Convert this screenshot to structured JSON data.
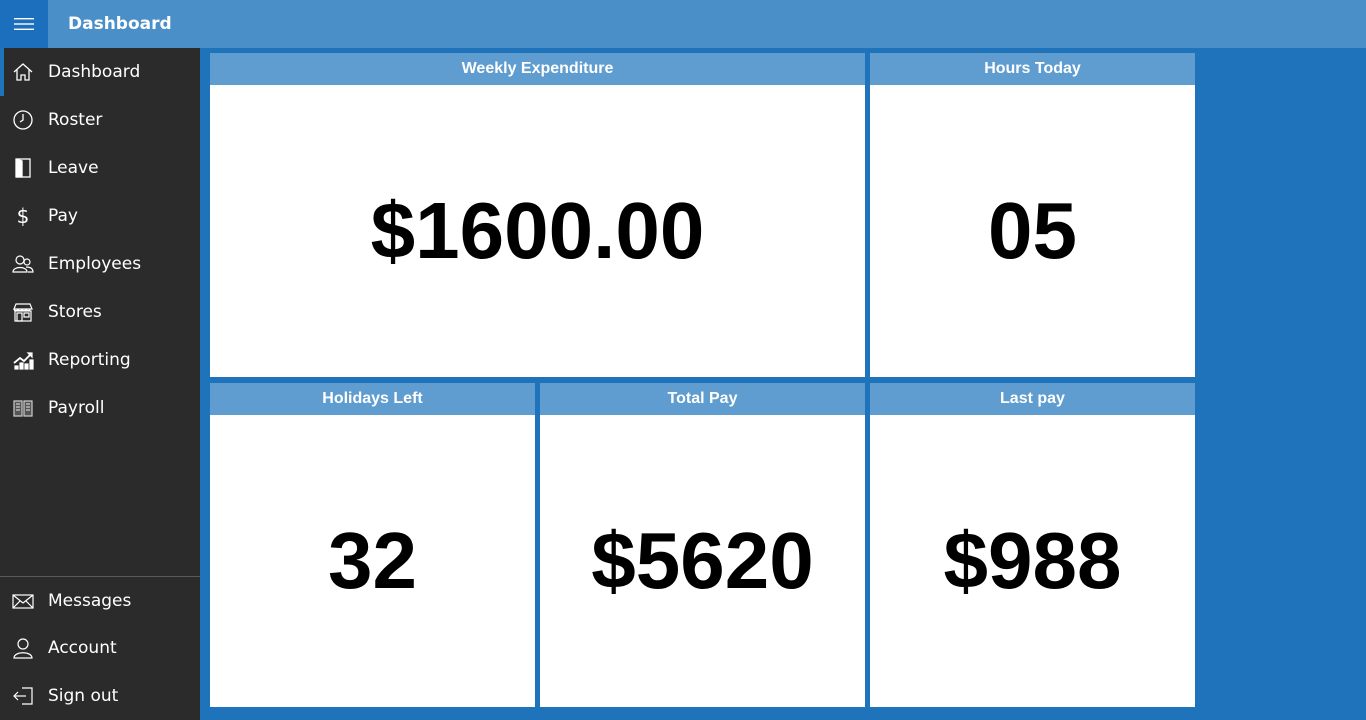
{
  "header": {
    "menu_icon": "hamburger-icon",
    "title": "Dashboard"
  },
  "sidebar": {
    "items": [
      {
        "label": "Dashboard",
        "icon": "home-icon",
        "active": true
      },
      {
        "label": "Roster",
        "icon": "clock-icon"
      },
      {
        "label": "Leave",
        "icon": "door-icon"
      },
      {
        "label": "Pay",
        "icon": "dollar-icon"
      },
      {
        "label": "Employees",
        "icon": "people-icon"
      },
      {
        "label": "Stores",
        "icon": "store-icon"
      },
      {
        "label": "Reporting",
        "icon": "chart-icon"
      },
      {
        "label": "Payroll",
        "icon": "book-icon"
      }
    ],
    "bottom_items": [
      {
        "label": "Messages",
        "icon": "mail-icon"
      },
      {
        "label": "Account",
        "icon": "user-icon"
      },
      {
        "label": "Sign out",
        "icon": "sign-out-icon"
      }
    ]
  },
  "cards": {
    "weekly_expenditure": {
      "title": "Weekly Expenditure",
      "value": "$1600.00"
    },
    "hours_today": {
      "title": "Hours Today",
      "value": "05"
    },
    "holidays_left": {
      "title": "Holidays Left",
      "value": "32"
    },
    "total_pay": {
      "title": "Total Pay",
      "value": "$5620"
    },
    "last_pay": {
      "title": "Last pay",
      "value": "$988"
    }
  },
  "colors": {
    "background": "#1e73bb",
    "topbar": "#4a8fc8",
    "sidebar": "#2b2b2b",
    "card_header": "#5f9ccf"
  }
}
